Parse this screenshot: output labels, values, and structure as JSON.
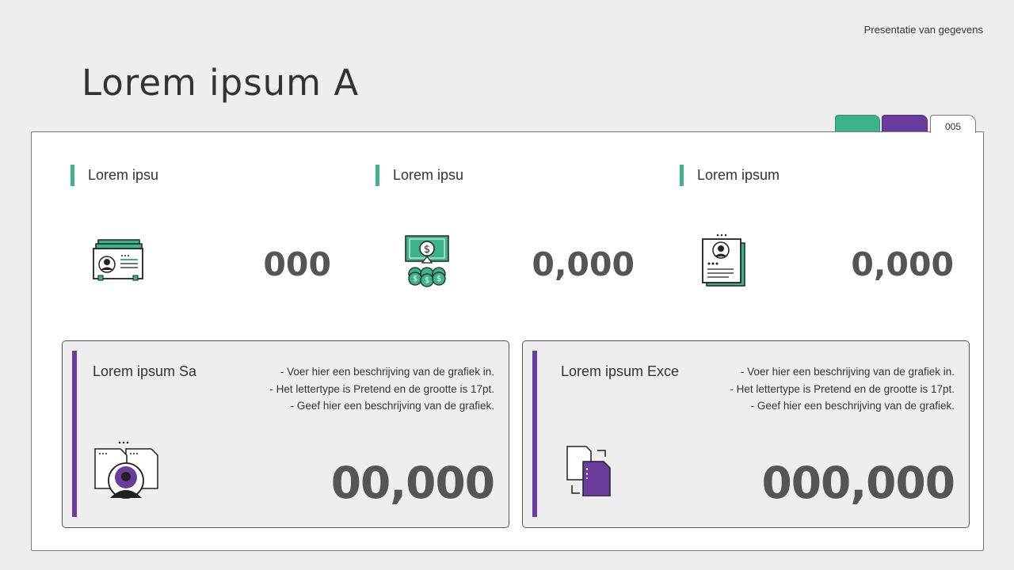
{
  "header": {
    "top_right_label": "Presentatie van gegevens",
    "title": "Lorem ipsum A",
    "page_number": "005"
  },
  "colors": {
    "accent_green": "#3db38a",
    "accent_purple": "#6a3c9e"
  },
  "stats": [
    {
      "label": "Lorem ipsu",
      "value": "000",
      "icon": "id-card-icon"
    },
    {
      "label": "Lorem ipsu",
      "value": "0,000",
      "icon": "money-coins-icon"
    },
    {
      "label": "Lorem ipsum",
      "value": "0,000",
      "icon": "resume-document-icon"
    }
  ],
  "cards": [
    {
      "title": "Lorem ipsum Sa",
      "lines": [
        "- Voer hier een beschrijving van de grafiek in.",
        "- Het lettertype is Pretend en de grootte is 17pt.",
        "- Geef hier een beschrijving van de grafiek."
      ],
      "value": "00,000",
      "icon": "person-documents-icon"
    },
    {
      "title": "Lorem ipsum Exce",
      "lines": [
        "- Voer hier een beschrijving van de grafiek in.",
        "- Het lettertype is Pretend en de grootte is 17pt.",
        "- Geef hier een beschrijving van de grafiek."
      ],
      "value": "000,000",
      "icon": "copy-files-icon"
    }
  ]
}
